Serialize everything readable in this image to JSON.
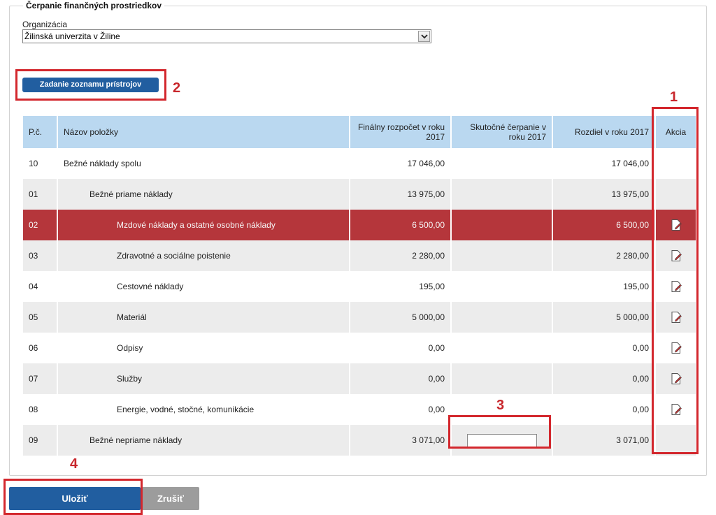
{
  "section": {
    "title": "Čerpanie finančných prostriedkov"
  },
  "organization": {
    "label": "Organizácia",
    "selected": "Žilinská univerzita v Žiline",
    "dropdown_icon": "chevron-down-icon"
  },
  "buttons": {
    "device_list": "Zadanie zoznamu prístrojov",
    "save": "Uložiť",
    "cancel": "Zrušiť"
  },
  "table": {
    "headers": {
      "pc": "P.č.",
      "name": "Názov položky",
      "budget": "Finálny rozpočet v roku 2017",
      "actual": "Skutočné čerpanie v roku 2017",
      "diff": "Rozdiel v roku 2017",
      "action": "Akcia"
    },
    "rows": [
      {
        "pc": "10",
        "name": "Bežné náklady spolu",
        "budget": "17 046,00",
        "actual": "",
        "diff": "17 046,00"
      },
      {
        "pc": "01",
        "name": "Bežné priame náklady",
        "budget": "13 975,00",
        "actual": "",
        "diff": "13 975,00"
      },
      {
        "pc": "02",
        "name": "Mzdové náklady a ostatné osobné náklady",
        "budget": "6 500,00",
        "actual": "",
        "diff": "6 500,00"
      },
      {
        "pc": "03",
        "name": "Zdravotné a sociálne poistenie",
        "budget": "2 280,00",
        "actual": "",
        "diff": "2 280,00"
      },
      {
        "pc": "04",
        "name": "Cestovné náklady",
        "budget": "195,00",
        "actual": "",
        "diff": "195,00"
      },
      {
        "pc": "05",
        "name": "Materiál",
        "budget": "5 000,00",
        "actual": "",
        "diff": "5 000,00"
      },
      {
        "pc": "06",
        "name": "Odpisy",
        "budget": "0,00",
        "actual": "",
        "diff": "0,00"
      },
      {
        "pc": "07",
        "name": "Služby",
        "budget": "0,00",
        "actual": "",
        "diff": "0,00"
      },
      {
        "pc": "08",
        "name": "Energie, vodné, stočné, komunikácie",
        "budget": "0,00",
        "actual": "",
        "diff": "0,00"
      },
      {
        "pc": "09",
        "name": "Bežné nepriame náklady",
        "budget": "3 071,00",
        "actual": "",
        "diff": "3 071,00"
      }
    ]
  },
  "annotations": {
    "n1": "1",
    "n2": "2",
    "n3": "3",
    "n4": "4"
  },
  "colors": {
    "accent": "#215ea0",
    "header": "#bad8f0",
    "selected_row": "#b5363b",
    "annotation": "#d3272d"
  }
}
